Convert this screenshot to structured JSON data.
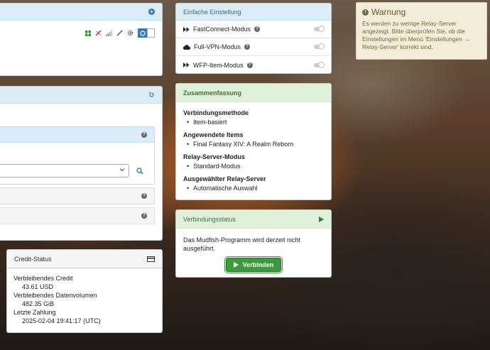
{
  "simple_settings": {
    "title": "Einfache Einstellung",
    "items": [
      {
        "label": "FastConnect-Modus"
      },
      {
        "label": "Full-VPN-Modus"
      },
      {
        "label": "WFP-Item-Modus"
      }
    ]
  },
  "summary": {
    "title": "Zusammenfassung",
    "sections": [
      {
        "label": "Verbindungsmethode",
        "value": "Item-basiert"
      },
      {
        "label": "Angewendete Items",
        "value": "Final Fantasy XIV: A Realm Reborn"
      },
      {
        "label": "Relay-Server-Modus",
        "value": "Standard-Modus"
      },
      {
        "label": "Ausgewählter Relay-Server",
        "value": "Automatische Auswahl"
      }
    ]
  },
  "connection_status": {
    "title": "Verbindungsstatus",
    "message": "Das Mudfish-Programm wird derzeit nicht ausgeführt.",
    "connect_label": "Verbinden"
  },
  "warning": {
    "title": "Warnung",
    "message": "Es werden zu wenige Relay-Server angezeigt. Bitte überprüfen Sie, ob die Einstellungen im Menü 'Einstellungen → Relay-Server' korrekt sind."
  },
  "credit_status": {
    "title": "Credit-Status",
    "remaining_credit_label": "Verbleibendes Credit",
    "remaining_credit_value": "43.61 USD",
    "remaining_data_label": "Verbleibendes Datenvolumen",
    "remaining_data_value": "482.35 GiB",
    "last_payment_label": "Letzte Zahlung",
    "last_payment_value": "2025-02-04 19:41:17 (UTC)"
  },
  "colors": {
    "accent": "#337ab7",
    "success": "#3c9a3c",
    "warning_bg": "#f2ecd8"
  }
}
